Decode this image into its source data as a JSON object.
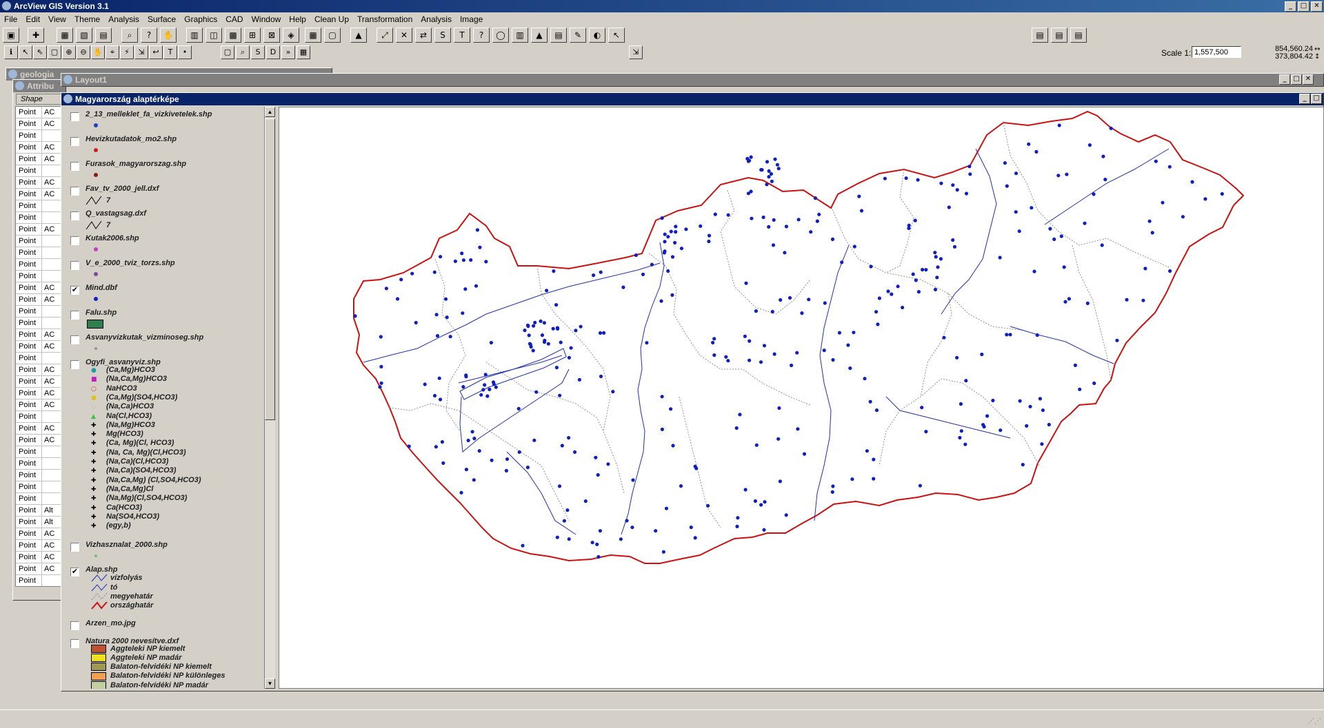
{
  "app": {
    "title": "ArcView GIS Version 3.1"
  },
  "menu": [
    "File",
    "Edit",
    "View",
    "Theme",
    "Analysis",
    "Surface",
    "Graphics",
    "CAD",
    "Window",
    "Help",
    "Clean Up",
    "Transformation",
    "Analysis",
    "Image"
  ],
  "scale": {
    "label": "Scale 1:",
    "value": "1,557,500"
  },
  "coords": {
    "x": "854,560.24",
    "y": "373,804.42"
  },
  "windows": {
    "geologia": "geologia",
    "attributes": "Attribu",
    "layout": "Layout1",
    "view": "Magyarország alaptérképe"
  },
  "attr_table": {
    "header": "Shape",
    "rows": [
      [
        "Point",
        "AC"
      ],
      [
        "Point",
        "AC"
      ],
      [
        "Point",
        ""
      ],
      [
        "Point",
        "AC"
      ],
      [
        "Point",
        "AC"
      ],
      [
        "Point",
        ""
      ],
      [
        "Point",
        "AC"
      ],
      [
        "Point",
        "AC"
      ],
      [
        "Point",
        ""
      ],
      [
        "Point",
        ""
      ],
      [
        "Point",
        "AC"
      ],
      [
        "Point",
        ""
      ],
      [
        "Point",
        ""
      ],
      [
        "Point",
        ""
      ],
      [
        "Point",
        ""
      ],
      [
        "Point",
        "AC"
      ],
      [
        "Point",
        "AC"
      ],
      [
        "Point",
        ""
      ],
      [
        "Point",
        ""
      ],
      [
        "Point",
        "AC"
      ],
      [
        "Point",
        "AC"
      ],
      [
        "Point",
        ""
      ],
      [
        "Point",
        "AC"
      ],
      [
        "Point",
        "AC"
      ],
      [
        "Point",
        "AC"
      ],
      [
        "Point",
        "AC"
      ],
      [
        "Point",
        ""
      ],
      [
        "Point",
        "AC"
      ],
      [
        "Point",
        "AC"
      ],
      [
        "Point",
        ""
      ],
      [
        "Point",
        ""
      ],
      [
        "Point",
        ""
      ],
      [
        "Point",
        ""
      ],
      [
        "Point",
        ""
      ],
      [
        "Point",
        "Alt"
      ],
      [
        "Point",
        "Alt"
      ],
      [
        "Point",
        "AC"
      ],
      [
        "Point",
        "AC"
      ],
      [
        "Point",
        "AC"
      ],
      [
        "Point",
        "AC"
      ],
      [
        "Point",
        ""
      ]
    ]
  },
  "legend": {
    "themes": [
      {
        "name": "2_13_melleklet_fa_vizkivetelek.shp",
        "checked": false,
        "color": "#1f3fbf",
        "kind": "dot"
      },
      {
        "name": "Hevizkutadatok_mo2.shp",
        "checked": false,
        "color": "#cc2020",
        "kind": "dot"
      },
      {
        "name": "Furasok_magyarorszag.shp",
        "checked": false,
        "color": "#8a1a1a",
        "kind": "dot"
      },
      {
        "name": "Fav_tv_2000_jell.dxf",
        "checked": false,
        "kind": "line",
        "label": "7"
      },
      {
        "name": "Q_vastagsag.dxf",
        "checked": false,
        "kind": "line",
        "label": "7"
      },
      {
        "name": "Kutak2006.shp",
        "checked": false,
        "color": "#c040c0",
        "kind": "dot"
      },
      {
        "name": "V_e_2000_tviz_torzs.shp",
        "checked": false,
        "color": "#7a4aa0",
        "kind": "dot"
      },
      {
        "name": "Mind.dbf",
        "checked": true,
        "color": "#1020c0",
        "kind": "dot"
      },
      {
        "name": "Falu.shp",
        "checked": false,
        "color": "#2e7d4f",
        "kind": "rect"
      },
      {
        "name": "Asvanyvizkutak_vizminoseg.shp",
        "checked": false,
        "color": "#9090a0",
        "kind": "small"
      },
      {
        "name": "Ogyfi_asvanyviz.shp",
        "checked": false,
        "kind": "classes"
      },
      {
        "name": "Vizhasznalat_2000.shp",
        "checked": false,
        "color": "#70c070",
        "kind": "small"
      },
      {
        "name": "Alap.shp",
        "checked": true,
        "kind": "alap"
      },
      {
        "name": "Arzen_mo.jpg",
        "checked": false,
        "kind": "none"
      },
      {
        "name": "Natura 2000 nevesítve.dxf",
        "checked": false,
        "kind": "natura"
      }
    ],
    "ogyfi_classes": [
      {
        "label": "(Ca,Mg)HCO3",
        "mark": "●",
        "color": "#20a0a0"
      },
      {
        "label": "(Na,Ca,Mg)HCO3",
        "mark": "■",
        "color": "#c020c0"
      },
      {
        "label": "NaHCO3",
        "mark": "○",
        "color": "#e03020"
      },
      {
        "label": "(Ca,Mg)(SO4,HCO3)",
        "mark": "●",
        "color": "#e0c020"
      },
      {
        "label": "(Na,Ca)HCO3",
        "mark": "◇",
        "color": "#c0c0a0"
      },
      {
        "label": "Na(Cl,HCO3)",
        "mark": "▲",
        "color": "#40c040"
      },
      {
        "label": "(Na,Mg)HCO3",
        "mark": "✚",
        "color": "#000"
      },
      {
        "label": "Mg(HCO3)",
        "mark": "✚",
        "color": "#000"
      },
      {
        "label": "(Ca, Mg)(Cl, HCO3)",
        "mark": "✚",
        "color": "#000"
      },
      {
        "label": "(Na, Ca, Mg)(Cl,HCO3)",
        "mark": "✚",
        "color": "#000"
      },
      {
        "label": "(Na,Ca)(Cl,HCO3)",
        "mark": "✚",
        "color": "#000"
      },
      {
        "label": "(Na,Ca)(SO4,HCO3)",
        "mark": "✚",
        "color": "#000"
      },
      {
        "label": "(Na,Ca,Mg) (Cl,SO4,HCO3)",
        "mark": "✚",
        "color": "#000"
      },
      {
        "label": "(Na,Ca,Mg)Cl",
        "mark": "✚",
        "color": "#000"
      },
      {
        "label": "(Na,Mg)(Cl,SO4,HCO3)",
        "mark": "✚",
        "color": "#000"
      },
      {
        "label": "Ca(HCO3)",
        "mark": "✚",
        "color": "#000"
      },
      {
        "label": "Na(SO4,HCO3)",
        "mark": "✚",
        "color": "#000"
      },
      {
        "label": "(egy,b)",
        "mark": "✚",
        "color": "#000"
      }
    ],
    "alap_classes": [
      {
        "label": "vízfolyás",
        "color": "#2030b0"
      },
      {
        "label": "tó",
        "color": "#2030b0"
      },
      {
        "label": "megyehatár",
        "color": "#808080"
      },
      {
        "label": "országhatár",
        "color": "#cc1010"
      }
    ],
    "natura_classes": [
      {
        "label": "Aggteleki NP kiemelt",
        "color": "#c05030"
      },
      {
        "label": "Aggteleki NP madár",
        "color": "#f0e020"
      },
      {
        "label": "Balaton-felvidéki NP kiemelt",
        "color": "#a09850"
      },
      {
        "label": "Balaton-felvidéki NP különleges",
        "color": "#f0a050"
      },
      {
        "label": "Balaton-felvidéki NP madár",
        "color": "#c0d0a0"
      }
    ]
  },
  "map": {
    "border_color": "#cc1010",
    "river_color": "#2030b0",
    "county_color": "#909090",
    "point_color": "#1020c0"
  }
}
